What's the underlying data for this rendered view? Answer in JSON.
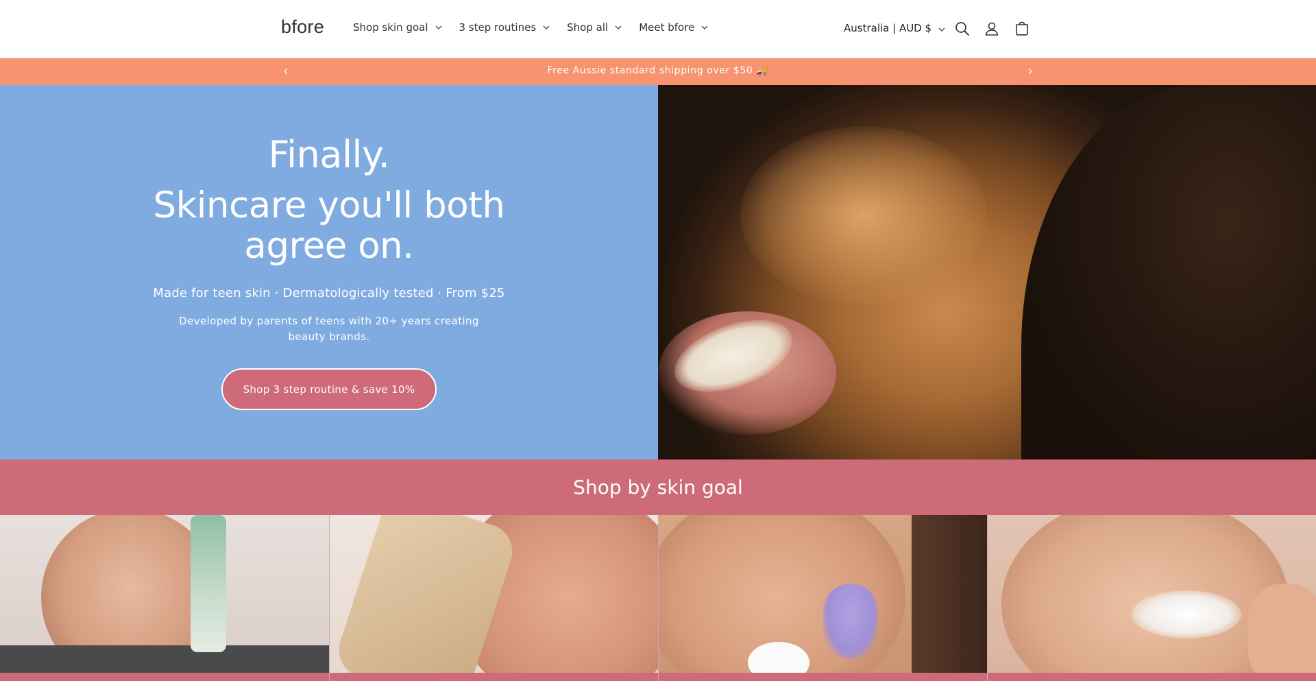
{
  "header": {
    "logo": "bfore",
    "nav": [
      {
        "label": "Shop skin goal"
      },
      {
        "label": "3 step routines"
      },
      {
        "label": "Shop all"
      },
      {
        "label": "Meet bfore"
      }
    ],
    "locale": "Australia | AUD $",
    "icons": [
      "search-icon",
      "account-icon",
      "cart-icon"
    ]
  },
  "announcement": {
    "text": "Free Aussie standard shipping over $50 🚚",
    "bg_color": "#f7936e"
  },
  "hero": {
    "title_line1": "Finally.",
    "title_line2": "Skincare you'll both agree on.",
    "subtitle": "Made for teen skin · Dermatologically tested · From $25",
    "description": "Developed by parents of teens with 20+ years creating beauty brands.",
    "cta": "Shop 3 step routine & save 10%",
    "bg_color": "#7fabe1",
    "cta_color": "#cf6a78"
  },
  "section": {
    "title": "Shop by skin goal",
    "bg_color": "#cd6b79",
    "tiles": [
      {
        "image": "young man holding green cleanser tube"
      },
      {
        "image": "bfore cleanser gel bottle beside smiling face"
      },
      {
        "image": "woman applying cream with lilac nails"
      },
      {
        "image": "smiling woman with face wash foam"
      }
    ]
  }
}
